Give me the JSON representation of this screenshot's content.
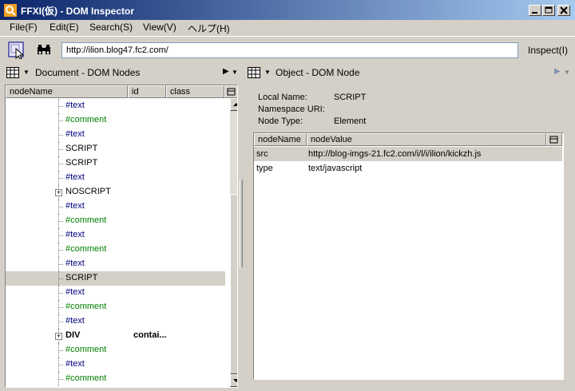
{
  "window": {
    "title": "FFXI(仮) - DOM Inspector",
    "minimize_label": "minimize",
    "maximize_label": "maximize",
    "close_label": "close"
  },
  "menu": [
    "File(F)",
    "Edit(E)",
    "Search(S)",
    "View(V)",
    "ヘルプ(H)"
  ],
  "toolbar": {
    "url_value": "http://ilion.blog47.fc2.com/",
    "inspect_label": "Inspect(I)"
  },
  "left_pane": {
    "title": "Document - DOM Nodes",
    "columns": [
      "nodeName",
      "id",
      "class"
    ],
    "rows": [
      {
        "name": "#text",
        "kind": "text",
        "id": "",
        "expander": "",
        "selected": false
      },
      {
        "name": "#comment",
        "kind": "comment",
        "id": "",
        "expander": "",
        "selected": false
      },
      {
        "name": "#text",
        "kind": "text",
        "id": "",
        "expander": "",
        "selected": false
      },
      {
        "name": "SCRIPT",
        "kind": "element",
        "id": "",
        "expander": "",
        "selected": false
      },
      {
        "name": "SCRIPT",
        "kind": "element",
        "id": "",
        "expander": "",
        "selected": false
      },
      {
        "name": "#text",
        "kind": "text",
        "id": "",
        "expander": "",
        "selected": false
      },
      {
        "name": "NOSCRIPT",
        "kind": "element",
        "id": "",
        "expander": "+",
        "selected": false
      },
      {
        "name": "#text",
        "kind": "text",
        "id": "",
        "expander": "",
        "selected": false
      },
      {
        "name": "#comment",
        "kind": "comment",
        "id": "",
        "expander": "",
        "selected": false
      },
      {
        "name": "#text",
        "kind": "text",
        "id": "",
        "expander": "",
        "selected": false
      },
      {
        "name": "#comment",
        "kind": "comment",
        "id": "",
        "expander": "",
        "selected": false
      },
      {
        "name": "#text",
        "kind": "text",
        "id": "",
        "expander": "",
        "selected": false
      },
      {
        "name": "SCRIPT",
        "kind": "element",
        "id": "",
        "expander": "",
        "selected": true
      },
      {
        "name": "#text",
        "kind": "text",
        "id": "",
        "expander": "",
        "selected": false
      },
      {
        "name": "#comment",
        "kind": "comment",
        "id": "",
        "expander": "",
        "selected": false
      },
      {
        "name": "#text",
        "kind": "text",
        "id": "",
        "expander": "",
        "selected": false
      },
      {
        "name": "DIV",
        "kind": "bold",
        "id": "contai...",
        "expander": "+",
        "selected": false
      },
      {
        "name": "#comment",
        "kind": "comment",
        "id": "",
        "expander": "",
        "selected": false
      },
      {
        "name": "#text",
        "kind": "text",
        "id": "",
        "expander": "",
        "selected": false
      },
      {
        "name": "#comment",
        "kind": "comment",
        "id": "",
        "expander": "",
        "selected": false
      }
    ]
  },
  "right_pane": {
    "title": "Object - DOM Node",
    "local_name_label": "Local Name:",
    "local_name_value": "SCRIPT",
    "namespace_label": "Namespace URI:",
    "namespace_value": "",
    "node_type_label": "Node Type:",
    "node_type_value": "Element",
    "columns": [
      "nodeName",
      "nodeValue"
    ],
    "rows": [
      {
        "name": "src",
        "value": "http://blog-imgs-21.fc2.com/i/l/i/ilion/kickzh.js",
        "selected": true
      },
      {
        "name": "type",
        "value": "text/javascript",
        "selected": false
      }
    ]
  },
  "colors": {
    "titlebar_start": "#0a246a",
    "titlebar_end": "#a6caf0",
    "text_node": "#000080",
    "comment_node": "#008000",
    "face": "#d4d0c8"
  }
}
